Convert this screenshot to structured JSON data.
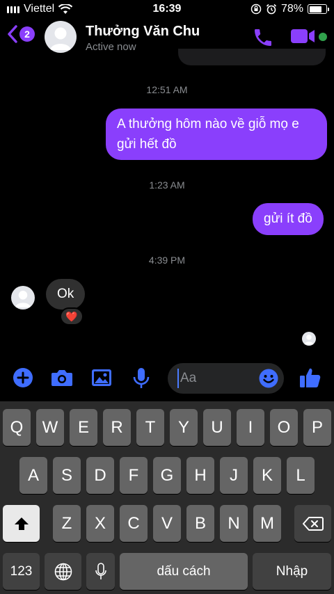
{
  "status_bar": {
    "carrier": "Viettel",
    "time": "16:39",
    "battery": "78%",
    "battery_level": 0.78
  },
  "header": {
    "back_badge": "2",
    "name": "Thưởng Văn Chu",
    "status": "Active now"
  },
  "messages": [
    {
      "type": "timestamp",
      "text": "12:51 AM"
    },
    {
      "type": "outgoing",
      "lines": [
        "A thưởng hôm nào về giỗ mọ e",
        "gửi hết đồ"
      ]
    },
    {
      "type": "timestamp",
      "text": "1:23 AM"
    },
    {
      "type": "outgoing",
      "text": "gửi ít đồ"
    },
    {
      "type": "timestamp",
      "text": "4:39 PM"
    },
    {
      "type": "incoming",
      "text": "Ok",
      "reaction": "❤️"
    }
  ],
  "composer": {
    "placeholder": "Aa"
  },
  "keyboard": {
    "row1": [
      "Q",
      "W",
      "E",
      "R",
      "T",
      "Y",
      "U",
      "I",
      "O",
      "P"
    ],
    "row2": [
      "A",
      "S",
      "D",
      "F",
      "G",
      "H",
      "J",
      "K",
      "L"
    ],
    "row3": [
      "Z",
      "X",
      "C",
      "V",
      "B",
      "N",
      "M"
    ],
    "numbers_key": "123",
    "space_key": "dấu cách",
    "return_key": "Nhập"
  },
  "colors": {
    "accent": "#8a3ffc",
    "online": "#31a24c",
    "composer_icons": "#3f6dff"
  }
}
